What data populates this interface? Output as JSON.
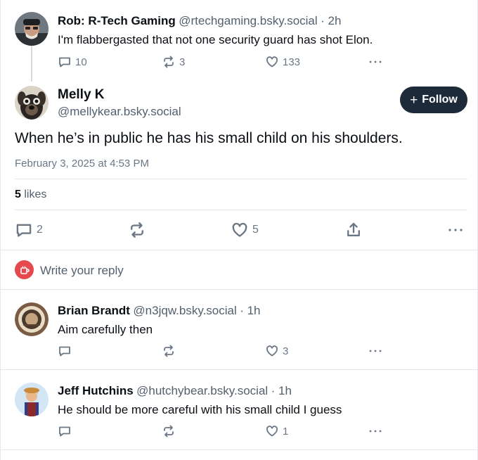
{
  "parent_post": {
    "author_name": "Rob: R-Tech Gaming",
    "author_handle": "@rtechgaming.bsky.social",
    "time": "· 2h",
    "text": "I'm flabbergasted that not one security guard has shot Elon.",
    "replies": "10",
    "reposts": "3",
    "likes": "133"
  },
  "main_post": {
    "author_name": "Melly K",
    "author_handle": "@mellykear.bsky.social",
    "follow_label": "Follow",
    "text": "When he’s in public he has his small child on his shoulders.",
    "timestamp": "February 3, 2025 at 4:53 PM",
    "likes_count": "5",
    "likes_label": "likes",
    "replies": "2",
    "like_count_action": "5"
  },
  "reply_box": {
    "placeholder": "Write your reply"
  },
  "replies": [
    {
      "author_name": "Brian Brandt",
      "author_handle": "@n3jqw.bsky.social",
      "time": "· 1h",
      "text": "Aim carefully then",
      "likes": "3"
    },
    {
      "author_name": "Jeff Hutchins",
      "author_handle": "@hutchybear.bsky.social",
      "time": "· 1h",
      "text": "He should be more careful with his small child I guess",
      "likes": "1"
    }
  ],
  "colors": {
    "text": "#0b0f14",
    "muted": "#6b7785",
    "follow_bg": "#1c2a3a",
    "reply_icon_bg": "#e5484d",
    "divider": "#e4e8ec"
  }
}
